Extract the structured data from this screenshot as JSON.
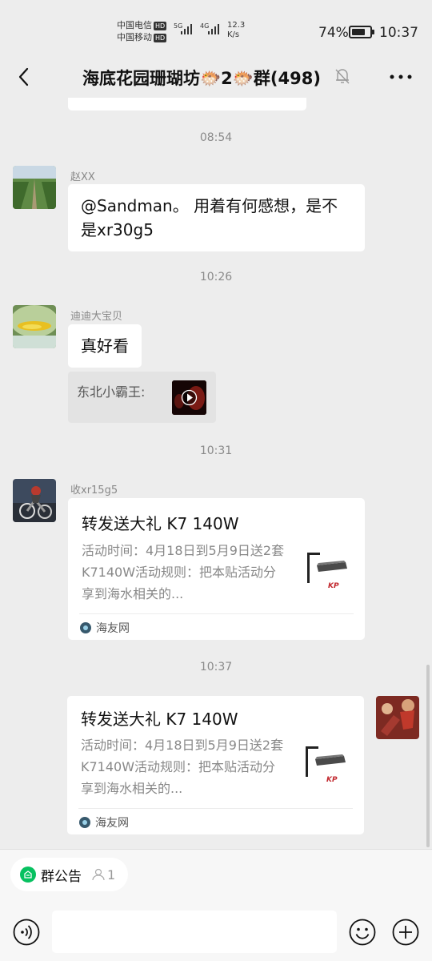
{
  "status_bar": {
    "carrier1": "中国电信",
    "carrier2": "中国移动",
    "hd": "HD",
    "net1": "5G",
    "net2": "4G",
    "speed_value": "12.3",
    "speed_unit": "K/s",
    "battery": "74%",
    "battery_level": 0.74,
    "time": "10:37"
  },
  "header": {
    "title": "海底花园珊瑚坊🐡2🐡群(498)",
    "icons": [
      "back-arrow-icon",
      "mute-bell-icon",
      "more-icon"
    ]
  },
  "messages": {
    "ts1": "08:54",
    "m1": {
      "sender": "赵XX",
      "text": "@Sandman。 用着有何感想，是不是xr30g5"
    },
    "ts2": "10:26",
    "m2": {
      "sender": "迪迪大宝贝",
      "text": "真好看",
      "quote": "东北小霸王:"
    },
    "ts3": "10:31",
    "m3": {
      "sender": "收xr15g5",
      "card_title": "转发送大礼 K7 140W",
      "card_desc": "活动时间：4月18日到5月9日送2套K7140W活动规则：把本贴活动分享到海水相关的...",
      "card_source": "海友网"
    },
    "ts4": "10:37",
    "m4": {
      "card_title": "转发送大礼 K7 140W",
      "card_desc": "活动时间：4月18日到5月9日送2套K7140W活动规则：把本贴活动分享到海水相关的...",
      "card_source": "海友网"
    }
  },
  "bottom": {
    "notice_label": "群公告",
    "notice_count": "1",
    "input_value": ""
  },
  "colors": {
    "background": "#ededed",
    "bubble": "#ffffff",
    "accent_green": "#07c160"
  }
}
